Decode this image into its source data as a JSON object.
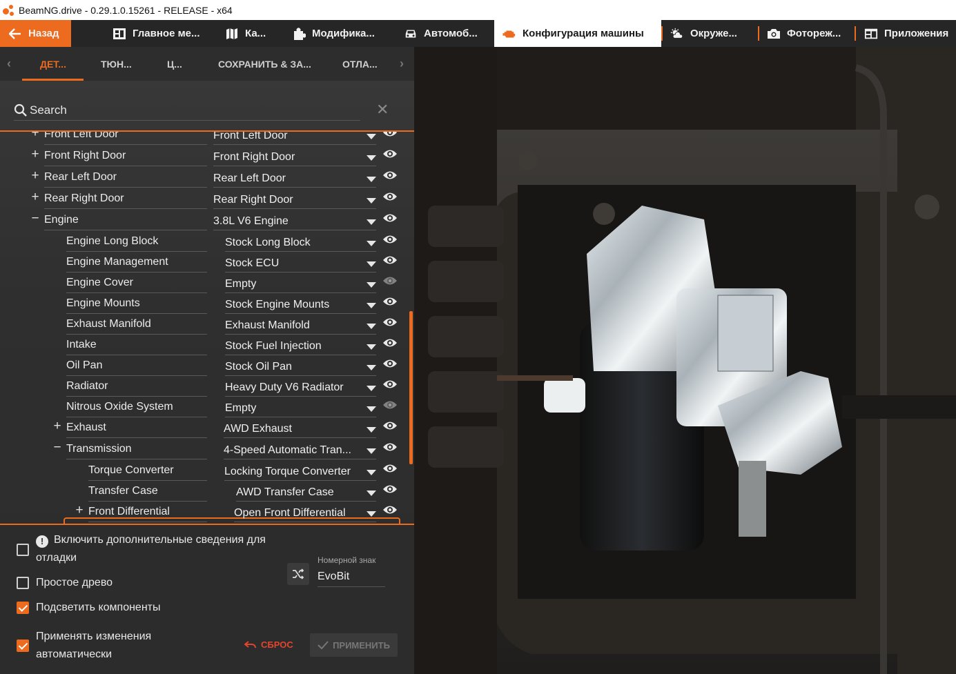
{
  "window": {
    "title": "BeamNG.drive - 0.29.1.0.15261 - RELEASE - x64"
  },
  "menu": {
    "back_label": "Назад",
    "items": [
      {
        "label": "Главное ме...",
        "icon": "dashboard-icon"
      },
      {
        "label": "Ка...",
        "icon": "map-icon"
      },
      {
        "label": "Модифика...",
        "icon": "puzzle-icon"
      },
      {
        "label": "Автомоб...",
        "icon": "car-icon"
      },
      {
        "label": "Конфигурация машины",
        "icon": "engine-icon",
        "active": true
      },
      {
        "label": "Окруже...",
        "icon": "weather-icon"
      },
      {
        "label": "Фотореж...",
        "icon": "camera-icon"
      },
      {
        "label": "Приложения",
        "icon": "apps-icon"
      }
    ]
  },
  "tabs": [
    {
      "label": "ДЕТ...",
      "active": true
    },
    {
      "label": "ТЮН..."
    },
    {
      "label": "Ц..."
    },
    {
      "label": "СОХРАНИТЬ & ЗА..."
    },
    {
      "label": "ОТЛА..."
    }
  ],
  "search": {
    "placeholder": "Search"
  },
  "tree": [
    {
      "name": "Front Left Door",
      "value": "Front Left Door",
      "expander": "+",
      "level": 0
    },
    {
      "name": "Front Right Door",
      "value": "Front Right Door",
      "expander": "+",
      "level": 0
    },
    {
      "name": "Rear Left Door",
      "value": "Rear Left Door",
      "expander": "+",
      "level": 0
    },
    {
      "name": "Rear Right Door",
      "value": "Rear Right Door",
      "expander": "+",
      "level": 0
    },
    {
      "name": "Engine",
      "value": "3.8L V6 Engine",
      "expander": "−",
      "level": 0
    },
    {
      "name": "Engine Long Block",
      "value": "Stock Long Block",
      "expander": "",
      "level": 1
    },
    {
      "name": "Engine Management",
      "value": "Stock ECU",
      "expander": "",
      "level": 1
    },
    {
      "name": "Engine Cover",
      "value": "Empty",
      "expander": "",
      "level": 1,
      "dim": true
    },
    {
      "name": "Engine Mounts",
      "value": "Stock Engine Mounts",
      "expander": "",
      "level": 1
    },
    {
      "name": "Exhaust Manifold",
      "value": "Exhaust Manifold",
      "expander": "",
      "level": 1
    },
    {
      "name": "Intake",
      "value": "Stock Fuel Injection",
      "expander": "",
      "level": 1
    },
    {
      "name": "Oil Pan",
      "value": "Stock Oil Pan",
      "expander": "",
      "level": 1
    },
    {
      "name": "Radiator",
      "value": "Heavy Duty V6 Radiator",
      "expander": "",
      "level": 1
    },
    {
      "name": "Nitrous Oxide System",
      "value": "Empty",
      "expander": "",
      "level": 1,
      "dim": true
    },
    {
      "name": "Exhaust",
      "value": "AWD Exhaust",
      "expander": "+",
      "level": 1
    },
    {
      "name": "Transmission",
      "value": "4-Speed Automatic Tran...",
      "expander": "−",
      "level": 1,
      "selected": true
    },
    {
      "name": "Torque Converter",
      "value": "Locking Torque Converter",
      "expander": "",
      "level": 2
    },
    {
      "name": "Transfer Case",
      "value": "AWD Transfer Case",
      "expander": "",
      "level": 2
    },
    {
      "name": "Front Differential",
      "value": "Open Front Differential",
      "expander": "+",
      "level": 2
    }
  ],
  "options": {
    "debug_label": "Включить дополнительные сведения для отладки",
    "debug_checked": false,
    "simple_tree_label": "Простое древо",
    "simple_tree_checked": false,
    "highlight_label": "Подсветить компоненты",
    "highlight_checked": true,
    "auto_apply_label": "Применять изменения автоматически",
    "auto_apply_checked": true
  },
  "license_plate": {
    "label": "Номерной знак",
    "value": "EvoBit"
  },
  "buttons": {
    "reset_label": "СБРОС",
    "apply_label": "ПРИМЕНИТЬ"
  },
  "colors": {
    "accent": "#ec6b1f",
    "panel": "#2f2f2f",
    "reset": "#e1452e"
  }
}
